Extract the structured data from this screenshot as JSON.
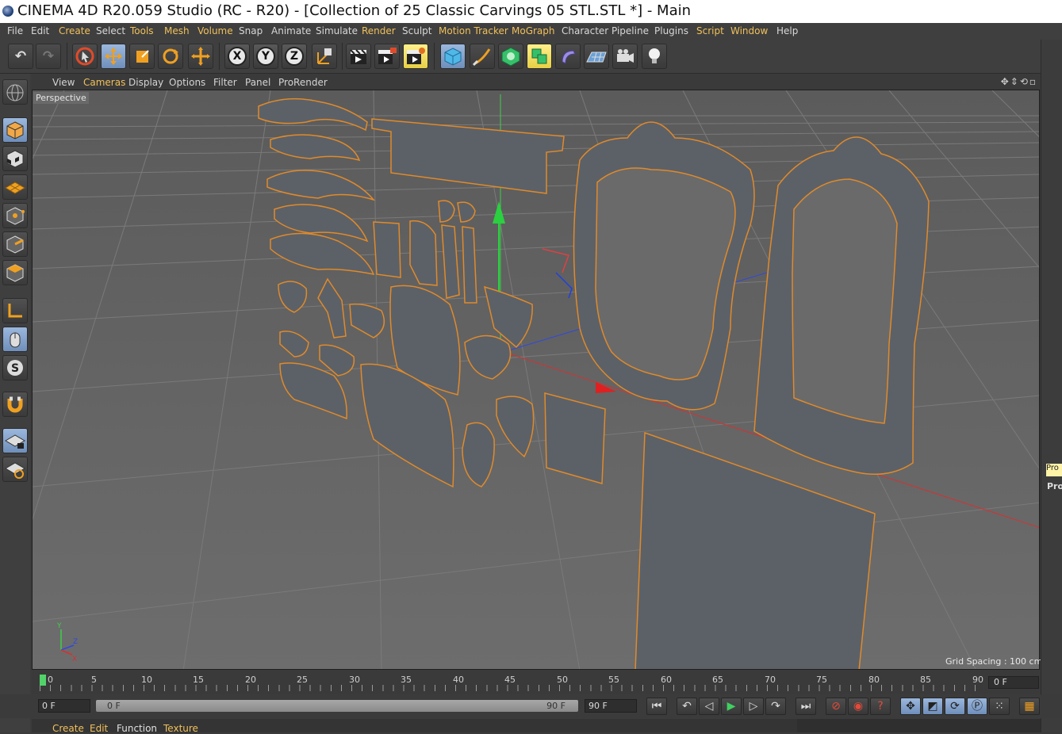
{
  "window": {
    "title": "CINEMA 4D R20.059 Studio (RC - R20) - [Collection of 25 Classic Carvings 05 STL.STL *] - Main"
  },
  "menu": {
    "items": [
      "File",
      "Edit",
      "Create",
      "Select",
      "Tools",
      "Mesh",
      "Volume",
      "Snap",
      "Animate",
      "Simulate",
      "Render",
      "Sculpt",
      "Motion Tracker",
      "MoGraph",
      "Character",
      "Pipeline",
      "Plugins",
      "Script",
      "Window",
      "Help"
    ]
  },
  "toolbar": {
    "axis_x": "X",
    "axis_y": "Y",
    "axis_z": "Z"
  },
  "viewport": {
    "menus": [
      "View",
      "Cameras",
      "Display",
      "Options",
      "Filter",
      "Panel",
      "ProRender"
    ],
    "camera_label": "Perspective",
    "grid_spacing": "Grid Spacing : 100 cm",
    "axis_x": "X",
    "axis_y": "Y",
    "axis_z": "Z"
  },
  "timeline": {
    "ticks": [
      "0",
      "5",
      "10",
      "15",
      "20",
      "25",
      "30",
      "35",
      "40",
      "45",
      "50",
      "55",
      "60",
      "65",
      "70",
      "75",
      "80",
      "85",
      "90"
    ],
    "end_frame": "0 F"
  },
  "controls": {
    "current_frame": "0 F",
    "range_start": "0 F",
    "range_end": "90 F",
    "max_frame": "90 F"
  },
  "material_menu": {
    "items": [
      "Create",
      "Edit",
      "Function",
      "Texture"
    ]
  },
  "right_panel": {
    "tag": "Pro",
    "label": "Proj"
  },
  "colors": {
    "accent_menu": "#f0c05a",
    "selection_outline": "#e08a2a",
    "axis_x": "#e03030",
    "axis_y": "#30c040",
    "axis_z": "#3050e0",
    "model_grey": "#5c6168"
  }
}
